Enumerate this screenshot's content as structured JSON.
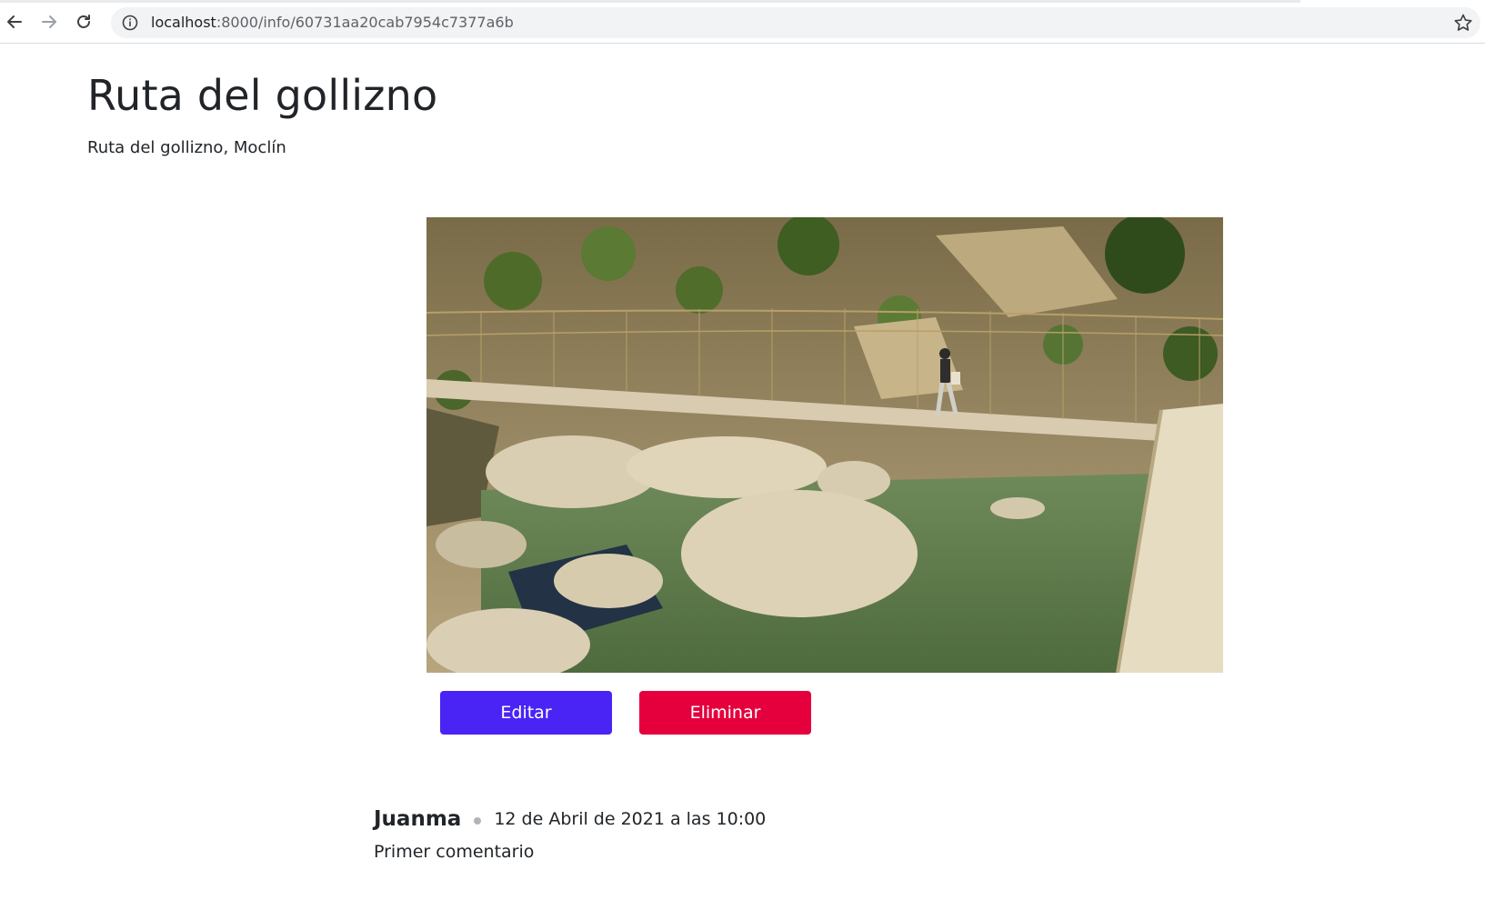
{
  "browser": {
    "url_host": "localhost",
    "url_path": ":8000/info/60731aa20cab7954c7377a6b",
    "icons": [
      "back-icon",
      "forward-icon",
      "reload-icon",
      "info-icon",
      "star-icon"
    ]
  },
  "route": {
    "title": "Ruta del gollizno",
    "subtitle": "Ruta del gollizno, Moclín",
    "image_description": "photo of a suspension footbridge over a green river with large limestone boulders"
  },
  "actions": {
    "edit_label": "Editar",
    "delete_label": "Eliminar",
    "edit_color": "#4a24f5",
    "delete_color": "#e5003d"
  },
  "comments": [
    {
      "author": "Juanma",
      "date": "12 de Abril de 2021 a las 10:00",
      "text": "Primer comentario"
    }
  ]
}
